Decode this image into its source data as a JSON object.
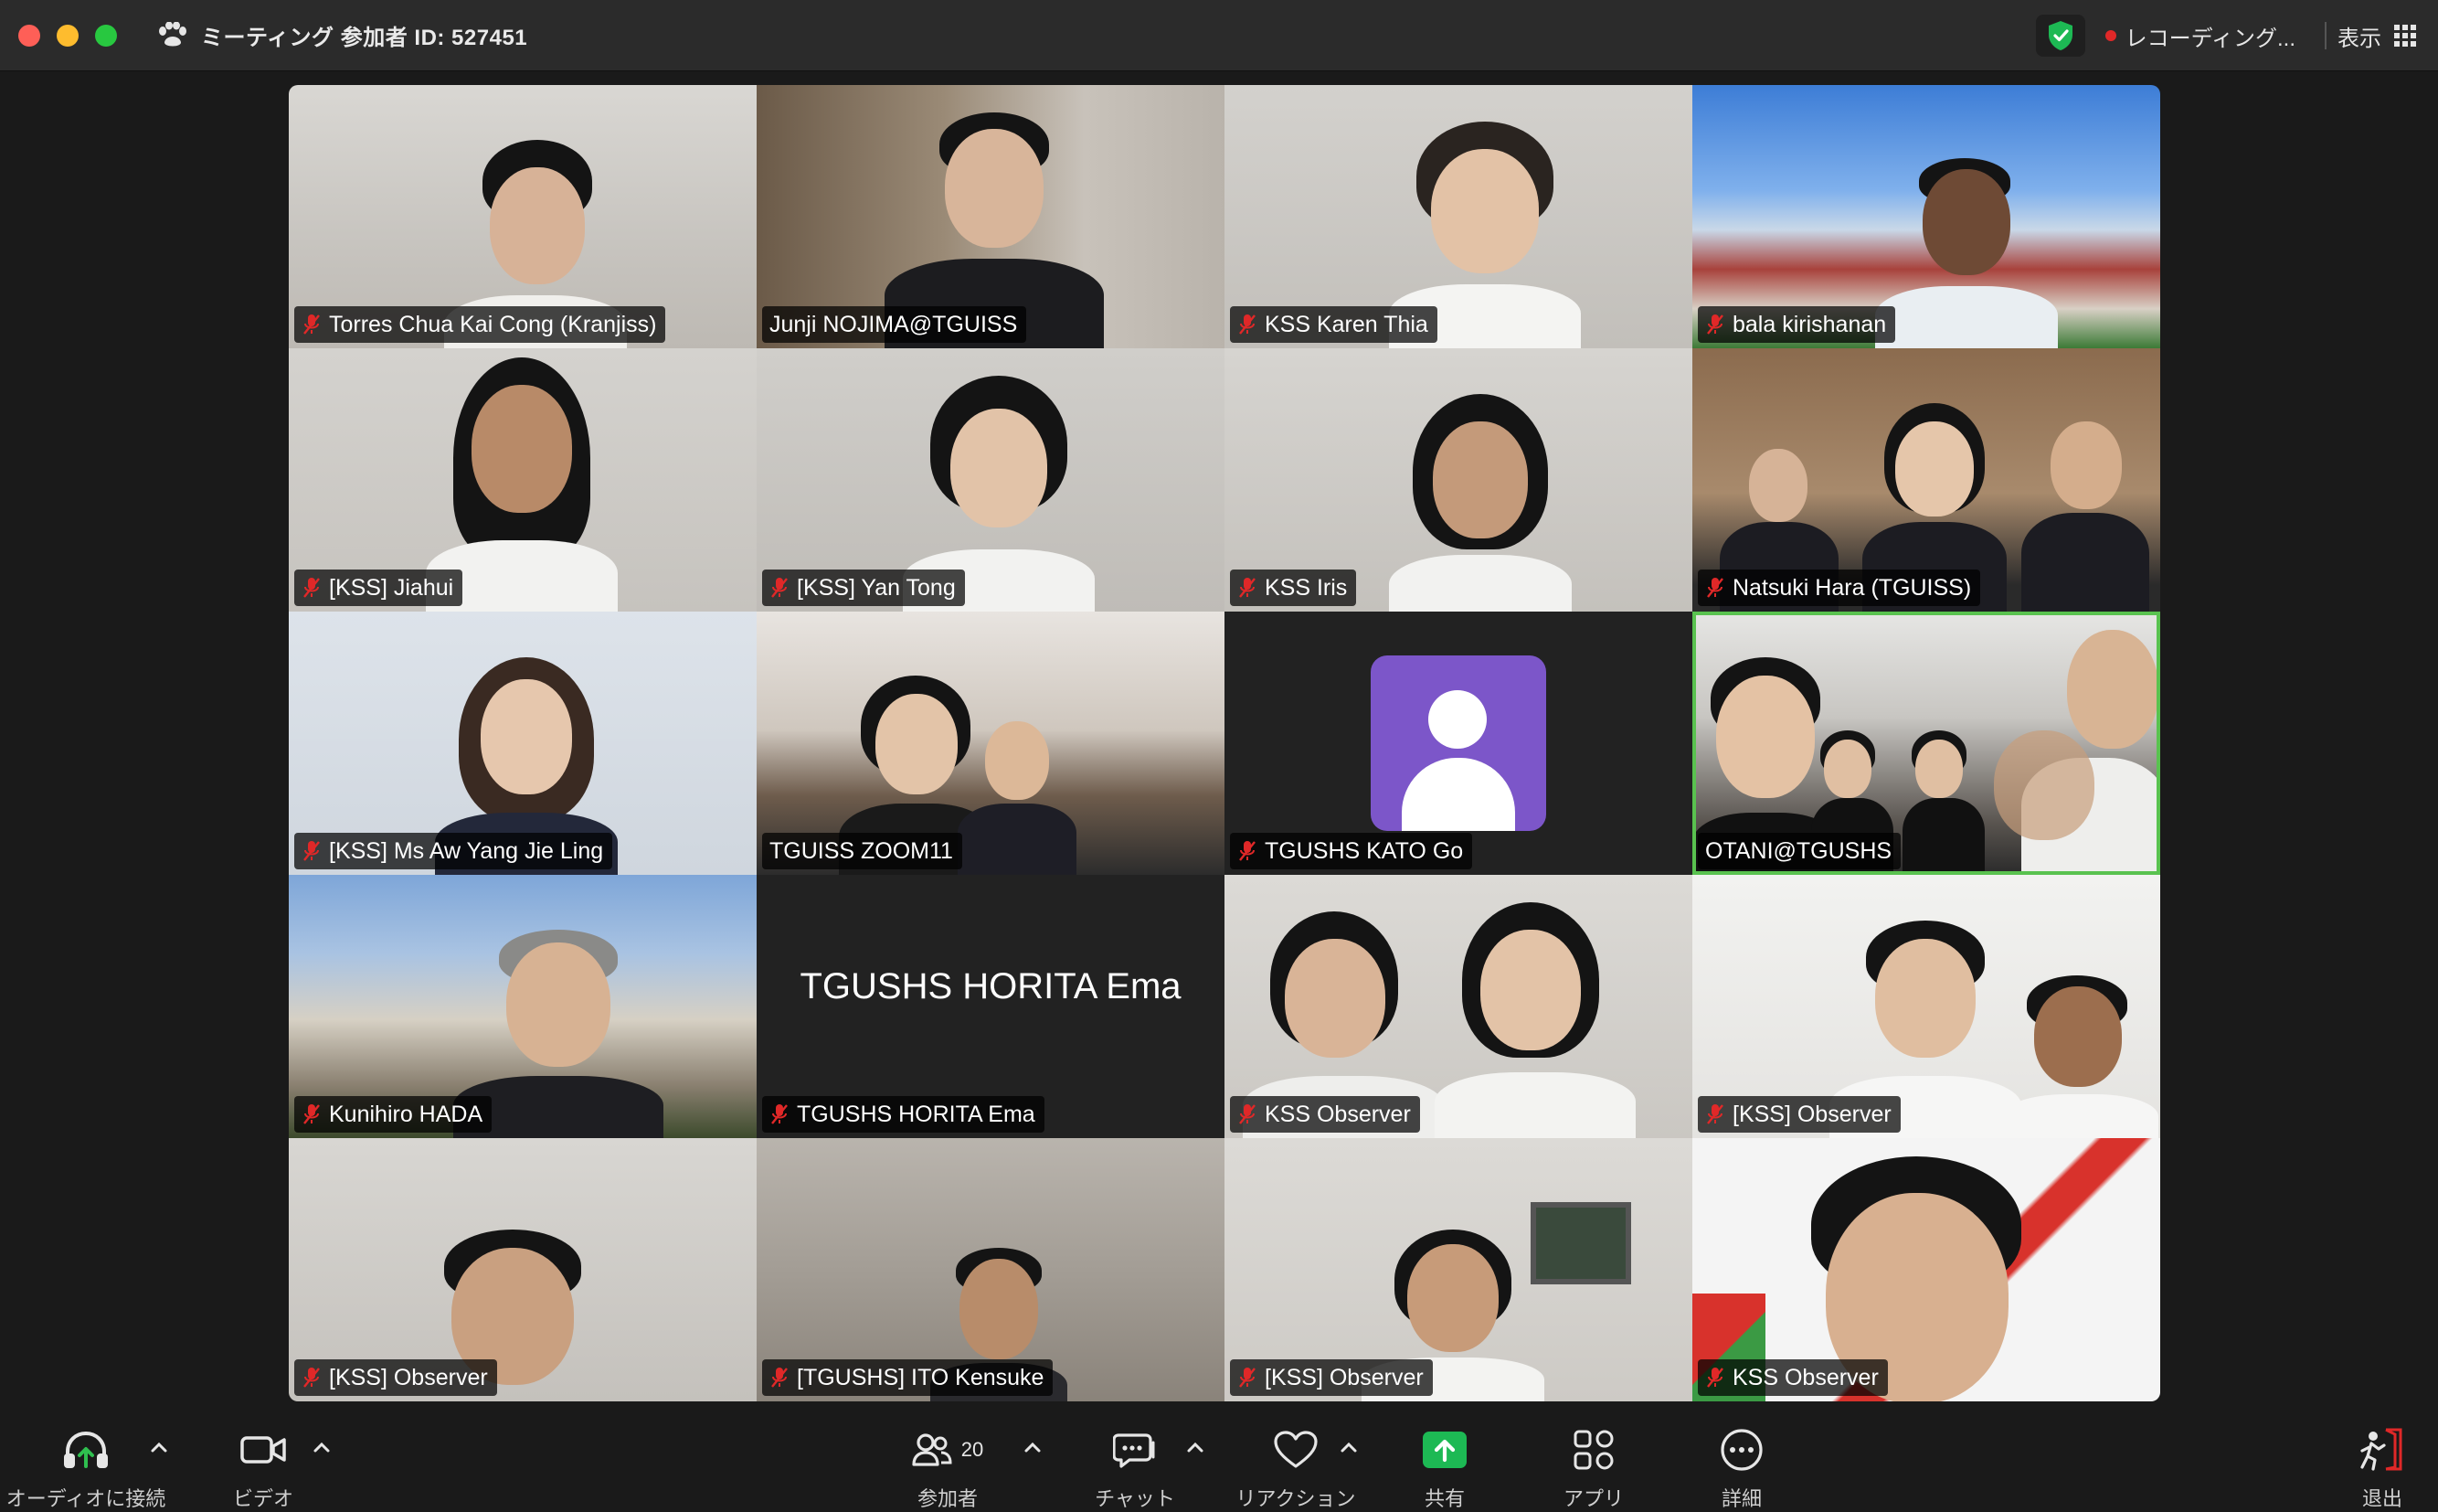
{
  "window": {
    "title": "ミーティング 参加者 ID: 527451",
    "recording_label": "レコーディング...",
    "view_label": "表示"
  },
  "participants": [
    {
      "name": "Torres Chua Kai Cong (Kranjiss)",
      "muted": true
    },
    {
      "name": "Junji NOJIMA@TGUISS",
      "muted": false
    },
    {
      "name": "KSS Karen Thia",
      "muted": true
    },
    {
      "name": "bala kirishanan",
      "muted": true
    },
    {
      "name": "[KSS] Jiahui",
      "muted": true
    },
    {
      "name": "[KSS] Yan Tong",
      "muted": true
    },
    {
      "name": "KSS Iris",
      "muted": true
    },
    {
      "name": "Natsuki Hara (TGUISS)",
      "muted": true
    },
    {
      "name": "[KSS] Ms Aw Yang Jie Ling",
      "muted": true
    },
    {
      "name": "TGUISS ZOOM11",
      "muted": false
    },
    {
      "name": "TGUSHS KATO Go",
      "muted": true,
      "video_off": true
    },
    {
      "name": "OTANI@TGUSHS",
      "muted": false,
      "active_speaker": true
    },
    {
      "name": "Kunihiro HADA",
      "muted": true
    },
    {
      "name": "TGUSHS HORITA Ema",
      "muted": true,
      "video_off": true,
      "display_name": "TGUSHS HORITA Ema"
    },
    {
      "name": "KSS Observer",
      "muted": true
    },
    {
      "name": "[KSS] Observer",
      "muted": true
    },
    {
      "name": "[KSS] Observer",
      "muted": true
    },
    {
      "name": "[TGUSHS] ITO Kensuke",
      "muted": true
    },
    {
      "name": "[KSS] Observer",
      "muted": true
    },
    {
      "name": "KSS Observer",
      "muted": true
    }
  ],
  "toolbar": {
    "audio_label": "オーディオに接続",
    "video_label": "ビデオ",
    "participants_label": "参加者",
    "participants_count": "20",
    "chat_label": "チャット",
    "reactions_label": "リアクション",
    "share_label": "共有",
    "apps_label": "アプリ",
    "more_label": "詳細",
    "leave_label": "退出"
  },
  "colors": {
    "titlebar_bg": "#2b2b2b",
    "app_bg": "#1a1a1a",
    "active_speaker_border": "#59c24f",
    "share_green": "#1db954",
    "muted_red": "#e02828",
    "avatar_purple": "#7c56c9"
  }
}
